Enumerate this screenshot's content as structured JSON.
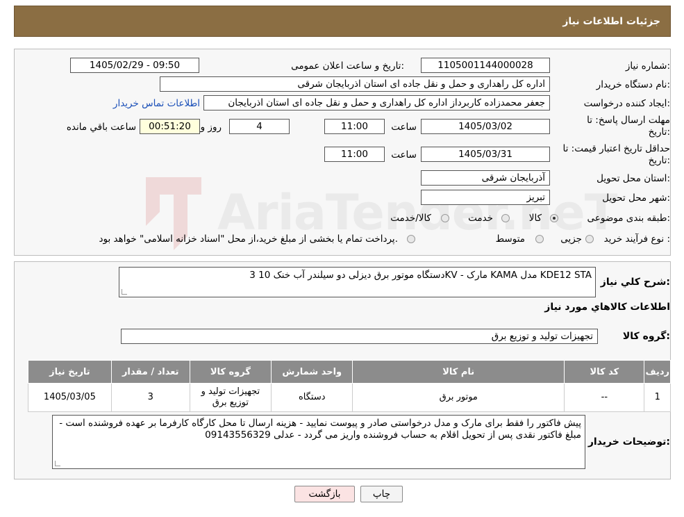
{
  "header": {
    "title": "جزئیات اطلاعات نیاز"
  },
  "form": {
    "need_number_label": "شماره نیاز:",
    "need_number": "1105001144000028",
    "announce_label": "تاریخ و ساعت اعلان عمومی:",
    "announce_value": "1405/02/29 - 09:50",
    "buyer_org_label": "نام دستگاه خریدار:",
    "buyer_org": "اداره کل راهداری و حمل و نقل جاده ای استان اذربایجان شرقی",
    "creator_label": "ایجاد کننده درخواست:",
    "creator": "جعفر محمدزاده کاربرداز اداره کل راهداری و حمل و نقل جاده ای استان اذربایجان",
    "contact_link": "اطلاعات تماس خریدار",
    "deadline_label_1": "مهلت ارسال پاسخ: تا",
    "deadline_label_2": "تاریخ:",
    "deadline_date": "1405/03/02",
    "time_label": "ساعت",
    "deadline_time": "11:00",
    "days_value": "4",
    "days_label": "روز و",
    "remaining_time": "00:51:20",
    "remaining_label": "ساعت باقي مانده",
    "validity_label_1": "حداقل تاريخ اعتبار قيمت: تا",
    "validity_label_2": "تاريخ:",
    "validity_date": "1405/03/31",
    "validity_time": "11:00",
    "province_label": "استان محل تحویل:",
    "province": "آذربایجان شرقی",
    "city_label": "شهر محل تحویل:",
    "city": "تبریز",
    "category_label": "طبقه بندی موضوعی:",
    "category_options": [
      "کالا",
      "خدمت",
      "کالا/خدمت"
    ],
    "process_label": "نوع فرآیند خرید :",
    "process_options": [
      "جزیی",
      "متوسط"
    ],
    "process_note": "پرداخت تمام یا بخشی از مبلغ خرید،از محل \"اسناد خزانه اسلامی\" خواهد بود."
  },
  "details": {
    "summary_label": "شرح کلي نياز:",
    "summary": "3 دستگاه موتور برق دیزلی دو سیلندر آب خنک 10KV - مارک KAMA مدل KDE12 STA",
    "goods_info_title": "اطلاعات کالاهاي مورد نياز",
    "group_label": "گروه کالا:",
    "group_value": "تجهیزات تولید و توزیع برق",
    "table": {
      "headers": [
        "رديف",
        "کد کالا",
        "نام کالا",
        "واحد شمارش",
        "گروه کالا",
        "تعداد / مقدار",
        "تاريخ نياز"
      ],
      "rows": [
        [
          "1",
          "--",
          "موتور برق",
          "دستگاه",
          "تجهیزات تولید و توزیع برق",
          "3",
          "1405/03/05"
        ]
      ]
    },
    "buyer_notes_label": "توضيحات خريدار:",
    "buyer_notes": "پیش فاکتور را فقط برای مارک و مدل درخواستی صادر و پیوست نمایید - هزینه ارسال تا محل کارگاه کارفرما بر عهده فروشنده است - مبلغ فاکتور نقدی پس از تحویل اقلام  به حساب فروشنده واریز می گردد - عدلی 09143556329"
  },
  "buttons": {
    "print": "چاپ",
    "back": "بازگشت"
  },
  "watermark": {
    "text": "AriaTender.neT"
  },
  "colors": {
    "header_bg": "#8b6e43",
    "table_header_bg": "#8c8c8c",
    "back_button_bg": "#fbe3e3",
    "link": "#1a4fb8"
  }
}
